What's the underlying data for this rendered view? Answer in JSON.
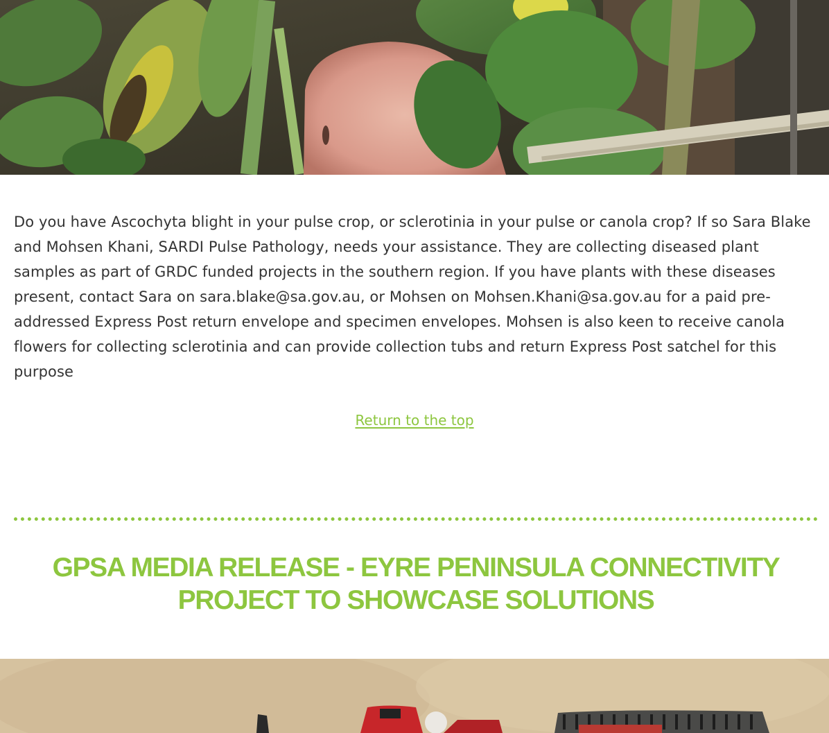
{
  "hero_image": {
    "subject": "leaves-with-fingertip-photo"
  },
  "article": {
    "body": "Do you have Ascochyta blight in your pulse crop, or sclerotinia in your pulse or canola crop? If so Sara Blake and Mohsen Khani, SARDI Pulse Pathology, needs your assistance. They are collecting diseased plant samples as part of GRDC funded projects in the southern region. If you have plants with these diseases present, contact Sara on sara.blake@sa.gov.au, or Mohsen on Mohsen.Khani@sa.gov.au for a paid pre-addressed Express Post return envelope and specimen envelopes.  Mohsen is also keen to receive canola flowers for collecting sclerotinia and can provide collection tubs and return Express Post satchel for this purpose",
    "return_link": "Return to the top"
  },
  "next_section": {
    "title": "GPSA MEDIA RELEASE - EYRE PENINSULA CONNECTIVITY PROJECT TO SHOWCASE SOLUTIONS"
  },
  "second_image": {
    "subject": "machinery-on-soil-photo"
  },
  "colors": {
    "accent_green": "#8dc63f",
    "body_text": "#333333",
    "background": "#ffffff"
  }
}
